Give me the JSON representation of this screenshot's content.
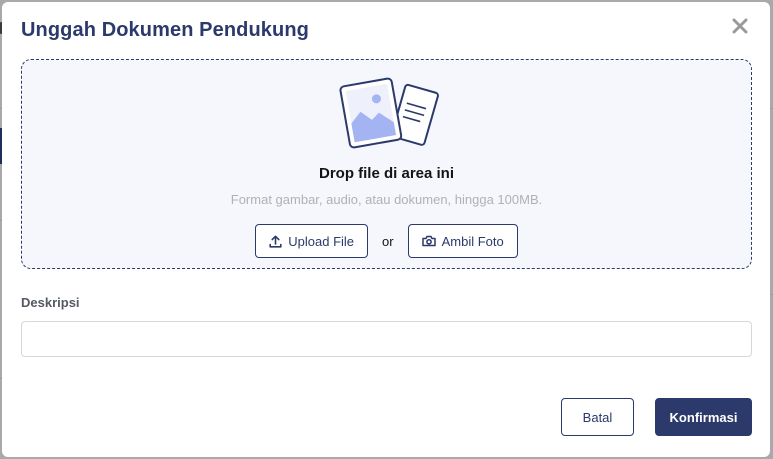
{
  "modal": {
    "title": "Unggah Dokumen Pendukung",
    "close_icon": "close-icon"
  },
  "dropzone": {
    "illustration_icon": "image-document-illustration",
    "title": "Drop file di area ini",
    "hint": "Format gambar, audio, atau dokumen, hingga 100MB.",
    "upload_label": "Upload File",
    "upload_icon": "upload-icon",
    "or_label": "or",
    "camera_label": "Ambil Foto",
    "camera_icon": "camera-icon"
  },
  "description": {
    "label": "Deskripsi",
    "value": "",
    "placeholder": ""
  },
  "footer": {
    "cancel_label": "Batal",
    "confirm_label": "Konfirmasi"
  },
  "colors": {
    "primary": "#2b3a6b",
    "dropzone_bg": "#f5f7fd",
    "overlay": "#a9a9ab",
    "illustration_accent": "#a4b3f2"
  }
}
